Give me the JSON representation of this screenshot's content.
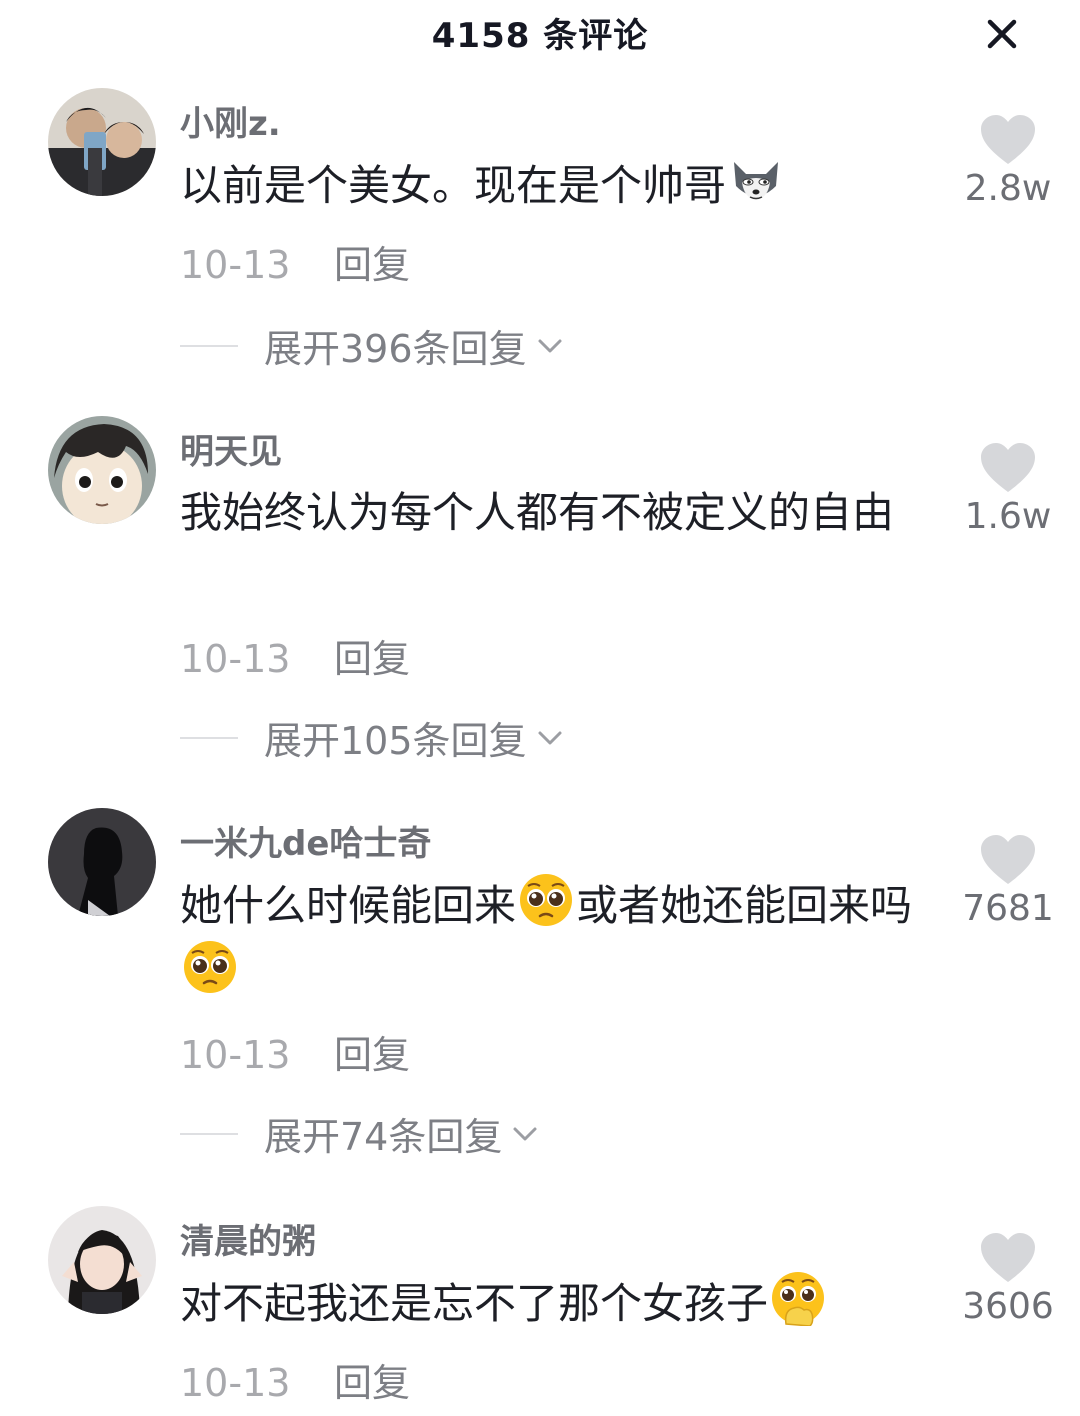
{
  "header": {
    "title": "4158 条评论",
    "close_icon": "close-icon"
  },
  "comments": [
    {
      "username": "小刚z.",
      "text": "以前是个美女。现在是个帅哥",
      "emoji": "wolf-face-icon",
      "date": "10-13",
      "reply_label": "回复",
      "expand_label": "展开396条回复",
      "likes": "2.8w"
    },
    {
      "username": "明天见",
      "text": "我始终认为每个人都有不被定义的自由",
      "date": "10-13",
      "reply_label": "回复",
      "expand_label": "展开105条回复",
      "likes": "1.6w"
    },
    {
      "username": "一米九de哈士奇",
      "text_part1": "她什么时候能回来",
      "text_part2": "或者她还能回来吗",
      "emoji": "pleading-face-icon",
      "date": "10-13",
      "reply_label": "回复",
      "expand_label": "展开74条回复",
      "likes": "7681"
    },
    {
      "username": "清晨的粥",
      "text": "对不起我还是忘不了那个女孩子",
      "emoji": "holding-back-tears-face-icon",
      "date": "10-13",
      "reply_label": "回复",
      "likes": "3606"
    }
  ],
  "colors": {
    "text_primary": "#1d1f26",
    "username": "#6c6e74",
    "meta": "#a8a9ad",
    "heart": "#d6d7da"
  }
}
